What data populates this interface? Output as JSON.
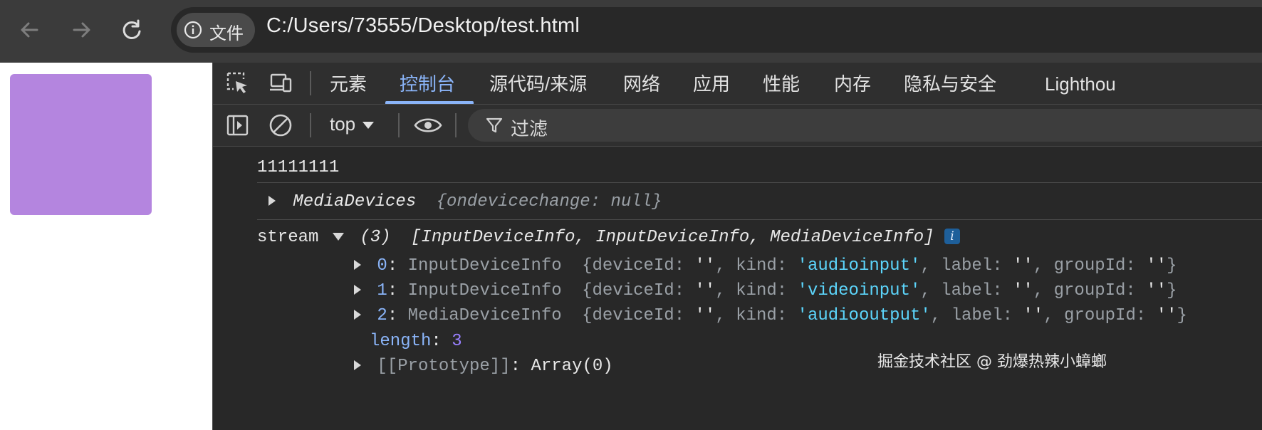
{
  "browser": {
    "site_info_label": "文件",
    "url": "C:/Users/73555/Desktop/test.html"
  },
  "devtools": {
    "tabs": [
      {
        "label": "元素"
      },
      {
        "label": "控制台",
        "active": true
      },
      {
        "label": "源代码/来源"
      },
      {
        "label": "网络"
      },
      {
        "label": "应用"
      },
      {
        "label": "性能"
      },
      {
        "label": "内存"
      },
      {
        "label": "隐私与安全"
      },
      {
        "label": "Lighthou"
      }
    ],
    "toolbar": {
      "context": "top",
      "filter_placeholder": "过滤"
    }
  },
  "console": {
    "log1": "11111111",
    "media": {
      "name": "MediaDevices",
      "key": "ondevicechange",
      "value": "null"
    },
    "stream": {
      "label": "stream",
      "count": "(3)",
      "summary": "[InputDeviceInfo, InputDeviceInfo, MediaDeviceInfo]",
      "items": [
        {
          "index": "0",
          "type": "InputDeviceInfo",
          "deviceId": "''",
          "kind": "'audioinput'",
          "label": "''",
          "groupId": "''"
        },
        {
          "index": "1",
          "type": "InputDeviceInfo",
          "deviceId": "''",
          "kind": "'videoinput'",
          "label": "''",
          "groupId": "''"
        },
        {
          "index": "2",
          "type": "MediaDeviceInfo",
          "deviceId": "''",
          "kind": "'audiooutput'",
          "label": "''",
          "groupId": "''"
        }
      ],
      "length_key": "length",
      "length_value": "3",
      "proto_key": "[[Prototype]]",
      "proto_value": "Array(0)"
    }
  },
  "watermark": "掘金技术社区 @ 劲爆热辣小蟑螂",
  "colors": {
    "purple_box": "#b485df",
    "accent": "#8ab4f8",
    "string": "#5cd5fb"
  }
}
